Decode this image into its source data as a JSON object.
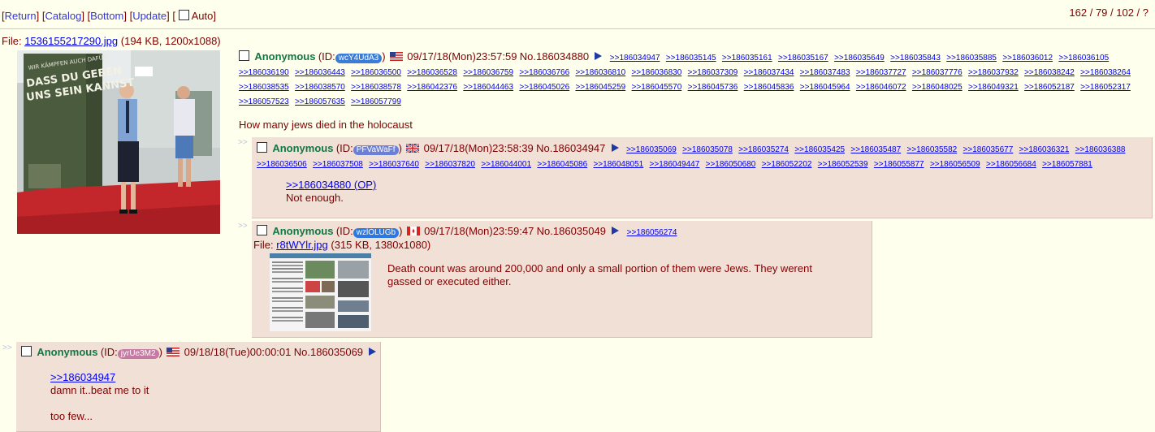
{
  "nav": {
    "return_label": "Return",
    "catalog_label": "Catalog",
    "bottom_label": "Bottom",
    "update_label": "Update",
    "auto_label": "Auto",
    "stats": "162 / 79 / 102 / ?"
  },
  "op": {
    "file_prefix": "File:",
    "file_name": "1536155217290.jpg",
    "file_info": "(194 KB, 1200x1088)",
    "name": "Anonymous",
    "id_prefix": "(ID:",
    "id": "wcY4UdA3",
    "id_suffix": ")",
    "id_color": "#3a7cd6",
    "date": "09/17/18(Mon)23:57:59",
    "no": "No.186034880",
    "backlinks": [
      ">>186034947",
      ">>186035145",
      ">>186035161",
      ">>186035167",
      ">>186035649",
      ">>186035843",
      ">>186035885",
      ">>186036012",
      ">>186036105",
      ">>186036190",
      ">>186036443",
      ">>186036500",
      ">>186036528",
      ">>186036759",
      ">>186036766",
      ">>186036810",
      ">>186036830",
      ">>186037309",
      ">>186037434",
      ">>186037483",
      ">>186037727",
      ">>186037776",
      ">>186037932",
      ">>186038242",
      ">>186038264",
      ">>186038535",
      ">>186038570",
      ">>186038578",
      ">>186042376",
      ">>186044463",
      ">>186045026",
      ">>186045259",
      ">>186045570",
      ">>186045736",
      ">>186045836",
      ">>186045964",
      ">>186046072",
      ">>186048025",
      ">>186049321",
      ">>186052187",
      ">>186052317",
      ">>186057523",
      ">>186057635",
      ">>186057799"
    ],
    "message": "How many jews died in the holocaust",
    "image_text": [
      "WIR KÄMPFEN AUCH DAFÜR,",
      "DASS DU GEBEN",
      "UNS SEIN KANNST"
    ]
  },
  "replies": [
    {
      "name": "Anonymous",
      "id_prefix": "(ID:",
      "id": "PFVaWaFf",
      "id_suffix": ")",
      "id_color": "#6b7fd8",
      "date": "09/17/18(Mon)23:58:39",
      "no": "No.186034947",
      "backlinks": [
        ">>186035069",
        ">>186035078",
        ">>186035274",
        ">>186035425",
        ">>186035487",
        ">>186035582",
        ">>186035677",
        ">>186036321",
        ">>186036388",
        ">>186036506",
        ">>186037508",
        ">>186037640",
        ">>186037820",
        ">>186044001",
        ">>186045086",
        ">>186048051",
        ">>186049447",
        ">>186050680",
        ">>186052202",
        ">>186052539",
        ">>186055877",
        ">>186056509",
        ">>186056684",
        ">>186057881"
      ],
      "quote": ">>186034880 (OP)",
      "message": "Not enough."
    },
    {
      "name": "Anonymous",
      "id_prefix": "(ID:",
      "id": "wzlOLUGb",
      "id_suffix": ")",
      "id_color": "#2d78e0",
      "date": "09/17/18(Mon)23:59:47",
      "no": "No.186035049",
      "backlinks": [
        ">>186056274"
      ],
      "file_prefix": "File:",
      "file_name": "r8tWYlr.jpg",
      "file_info": "(315 KB, 1380x1080)",
      "message_line1": "Death count was around 200,000 and only a small portion of them were Jews. They werent",
      "message_line2": "gassed or executed either."
    },
    {
      "name": "Anonymous",
      "id_prefix": "(ID:",
      "id": "jyrUe3M2",
      "id_suffix": ")",
      "id_color": "#c47aa3",
      "date": "09/18/18(Tue)00:00:01",
      "no": "No.186035069",
      "quote": ">>186034947",
      "message_line1": "damn it..beat me to it",
      "message_line2": "too few..."
    }
  ],
  "arrow_glyph": ">>"
}
